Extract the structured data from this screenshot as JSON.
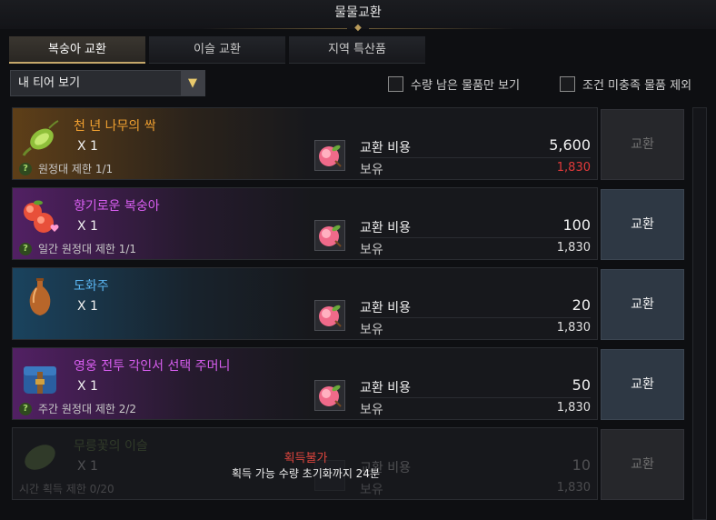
{
  "window": {
    "title": "물물교환"
  },
  "tabs": [
    {
      "label": "복숭아 교환",
      "active": true
    },
    {
      "label": "이슬 교환",
      "active": false
    },
    {
      "label": "지역 특산품",
      "active": false
    }
  ],
  "filter": {
    "dropdown_value": "내 티어 보기",
    "dropdown_icon": "chevron-down-icon",
    "check_remaining": {
      "label": "수량 남은 물품만 보기",
      "checked": false
    },
    "check_exclude": {
      "label": "조건 미충족 물품 제외",
      "checked": false
    }
  },
  "colors": {
    "orange_name": "#f0a030",
    "purple_name": "#d85ef0",
    "blue_name": "#5ab4f0",
    "red_text": "#e23a3a",
    "accent_gold": "#c5a76a"
  },
  "items": [
    {
      "name": "천 년 나무의 싹",
      "name_color": "#f0a030",
      "icon": "seed-sprout-icon",
      "qty": "X 1",
      "limit": "원정대 제한 1/1",
      "cost_label": "교환 비용",
      "cost": "5,600",
      "own_label": "보유",
      "own": "1,830",
      "own_insufficient": true,
      "button": "교환",
      "button_enabled": false,
      "locked": false
    },
    {
      "name": "향기로운 복숭아",
      "name_color": "#d85ef0",
      "icon": "peach-icon",
      "qty": "X 1",
      "limit": "일간 원정대 제한 1/1",
      "cost_label": "교환 비용",
      "cost": "100",
      "own_label": "보유",
      "own": "1,830",
      "own_insufficient": false,
      "button": "교환",
      "button_enabled": true,
      "locked": false
    },
    {
      "name": "도화주",
      "name_color": "#5ab4f0",
      "icon": "vase-icon",
      "qty": "X 1",
      "limit": "",
      "cost_label": "교환 비용",
      "cost": "20",
      "own_label": "보유",
      "own": "1,830",
      "own_insufficient": false,
      "button": "교환",
      "button_enabled": true,
      "locked": false
    },
    {
      "name": "영웅 전투 각인서 선택 주머니",
      "name_color": "#d85ef0",
      "icon": "pouch-icon",
      "qty": "X 1",
      "limit": "주간 원정대 제한 2/2",
      "cost_label": "교환 비용",
      "cost": "50",
      "own_label": "보유",
      "own": "1,830",
      "own_insufficient": false,
      "button": "교환",
      "button_enabled": true,
      "locked": false
    },
    {
      "name": "무릉꽃의 이슬",
      "name_color": "#7aa050",
      "icon": "dew-icon",
      "qty": "X 1",
      "limit": "시간 획득 제한 0/20",
      "cost_label": "교환 비용",
      "cost": "10",
      "own_label": "보유",
      "own": "1,830",
      "own_insufficient": false,
      "button": "교환",
      "button_enabled": false,
      "locked": true,
      "overlay_title": "획득불가",
      "overlay_sub": "획득 가능 수량 초기화까지 24분"
    }
  ],
  "currency_icon": "peach-coin-icon"
}
